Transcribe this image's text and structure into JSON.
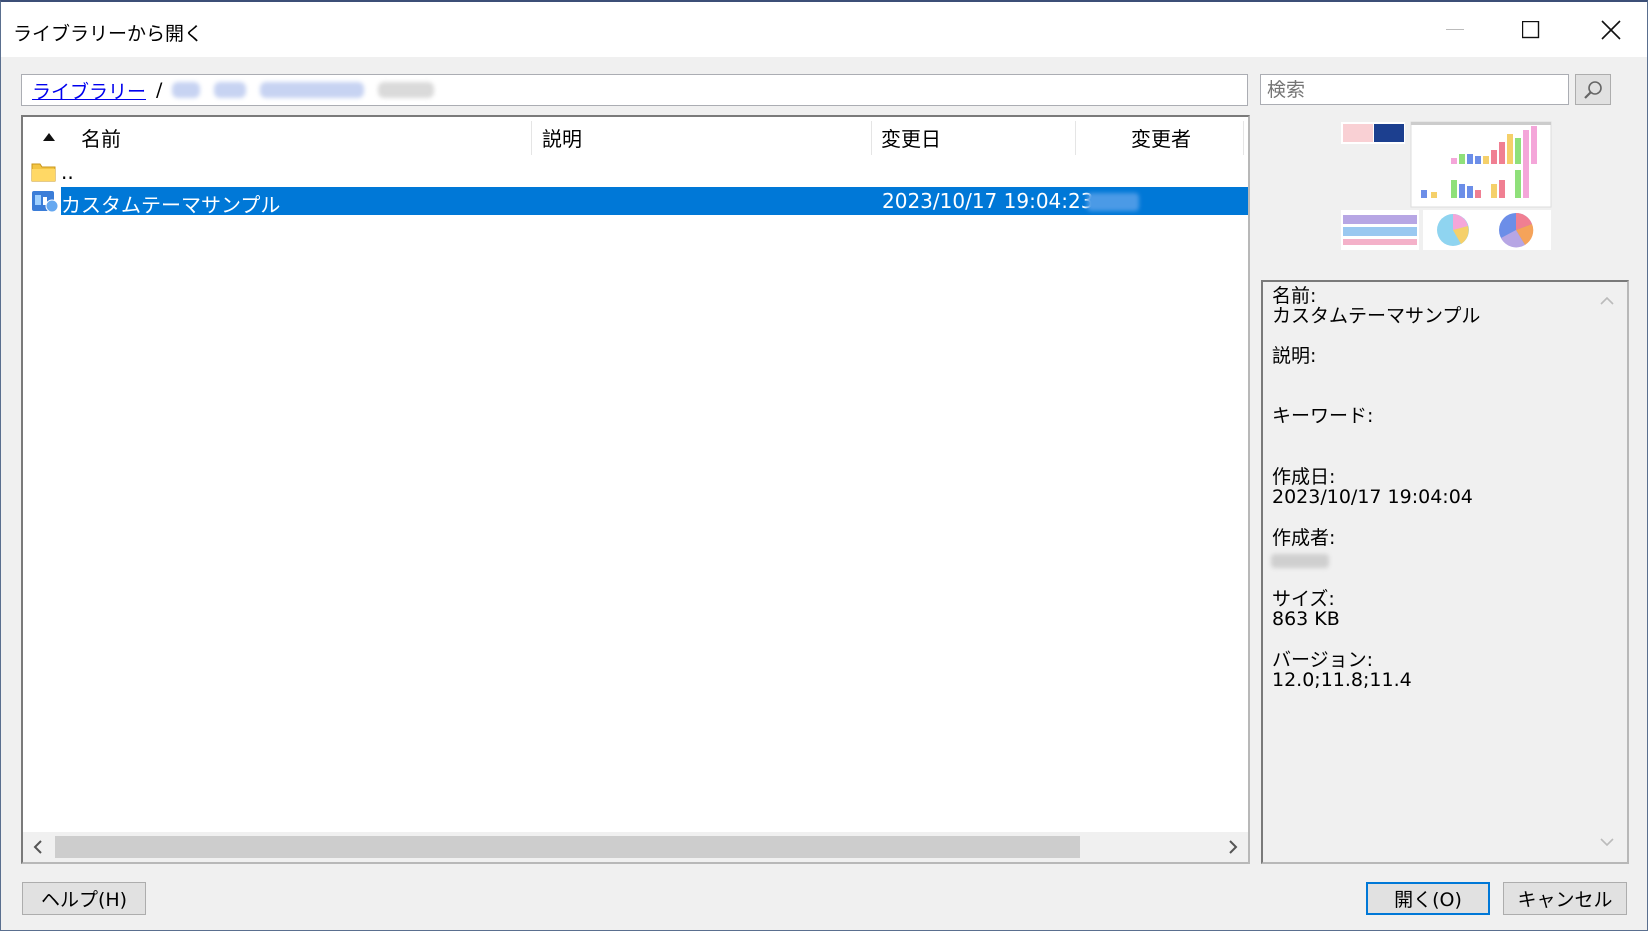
{
  "window": {
    "title": "ライブラリーから開く"
  },
  "breadcrumb": {
    "root": "ライブラリー",
    "separator": "/"
  },
  "search": {
    "placeholder": "検索"
  },
  "list": {
    "columns": [
      "名前",
      "説明",
      "変更日",
      "変更者"
    ],
    "rows": [
      {
        "name": "..",
        "type": "folder"
      },
      {
        "name": "カスタムテーマサンプル",
        "modified": "2023/10/17 19:04:23",
        "type": "theme",
        "selected": true
      }
    ]
  },
  "info": {
    "name_label": "名前:",
    "name_value": "カスタムテーマサンプル",
    "description_label": "説明:",
    "keywords_label": "キーワード:",
    "created_label": "作成日:",
    "created_value": "2023/10/17 19:04:04",
    "author_label": "作成者:",
    "size_label": "サイズ:",
    "size_value": "863 KB",
    "version_label": "バージョン:",
    "version_value": "12.0;11.8;11.4"
  },
  "buttons": {
    "help": "ヘルプ(H)",
    "open": "開く(O)",
    "cancel": "キャンセル"
  },
  "colors": {
    "selection": "#0078d7",
    "link": "#0000ee"
  }
}
